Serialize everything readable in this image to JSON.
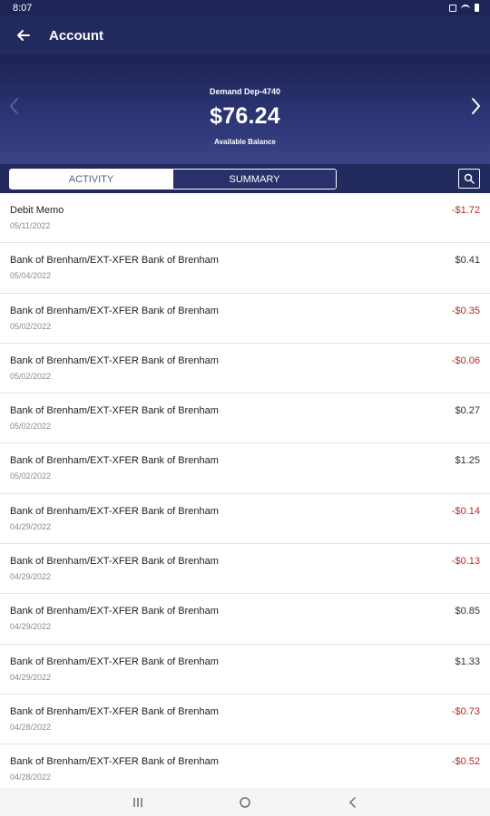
{
  "status_bar": {
    "time": "8:07"
  },
  "app_bar": {
    "title": "Account"
  },
  "account": {
    "name": "Demand Dep-4740",
    "balance": "$76.24",
    "balance_label": "Available Balance"
  },
  "tabs": [
    {
      "label": "ACTIVITY",
      "active": true
    },
    {
      "label": "SUMMARY",
      "active": false
    }
  ],
  "transactions": [
    {
      "description": "Debit Memo",
      "date": "05/11/2022",
      "amount": "-$1.72",
      "negative": true
    },
    {
      "description": "Bank of Brenham/EXT-XFER Bank of Brenham",
      "date": "05/04/2022",
      "amount": "$0.41",
      "negative": false
    },
    {
      "description": "Bank of Brenham/EXT-XFER Bank of Brenham",
      "date": "05/02/2022",
      "amount": "-$0.35",
      "negative": true
    },
    {
      "description": "Bank of Brenham/EXT-XFER Bank of Brenham",
      "date": "05/02/2022",
      "amount": "-$0.06",
      "negative": true
    },
    {
      "description": "Bank of Brenham/EXT-XFER Bank of Brenham",
      "date": "05/02/2022",
      "amount": "$0.27",
      "negative": false
    },
    {
      "description": "Bank of Brenham/EXT-XFER Bank of Brenham",
      "date": "05/02/2022",
      "amount": "$1.25",
      "negative": false
    },
    {
      "description": "Bank of Brenham/EXT-XFER Bank of Brenham",
      "date": "04/29/2022",
      "amount": "-$0.14",
      "negative": true
    },
    {
      "description": "Bank of Brenham/EXT-XFER Bank of Brenham",
      "date": "04/29/2022",
      "amount": "-$0.13",
      "negative": true
    },
    {
      "description": "Bank of Brenham/EXT-XFER Bank of Brenham",
      "date": "04/29/2022",
      "amount": "$0.85",
      "negative": false
    },
    {
      "description": "Bank of Brenham/EXT-XFER Bank of Brenham",
      "date": "04/29/2022",
      "amount": "$1.33",
      "negative": false
    },
    {
      "description": "Bank of Brenham/EXT-XFER Bank of Brenham",
      "date": "04/28/2022",
      "amount": "-$0.73",
      "negative": true
    },
    {
      "description": "Bank of Brenham/EXT-XFER Bank of Brenham",
      "date": "04/28/2022",
      "amount": "-$0.52",
      "negative": true
    }
  ],
  "colors": {
    "header": "#232a5e",
    "negative_amount": "#b32a2a",
    "positive_amount": "#333333"
  },
  "icons": {
    "back": "back-arrow-icon",
    "prev": "chevron-left-icon",
    "next": "chevron-right-icon",
    "search": "search-icon",
    "recents": "recents-icon",
    "home": "home-icon",
    "back_nav": "back-nav-icon"
  }
}
